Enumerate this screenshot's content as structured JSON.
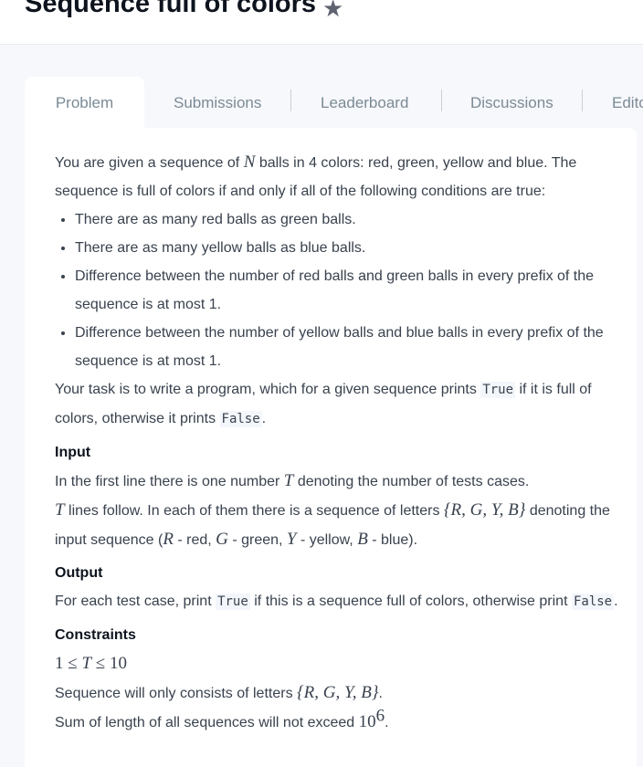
{
  "header": {
    "title": "Sequence full of colors",
    "star_icon": "star-icon"
  },
  "tabs": [
    "Problem",
    "Submissions",
    "Leaderboard",
    "Discussions",
    "Editorial"
  ],
  "content": [
    {
      "kind": "p",
      "segs": [
        [
          "t",
          "You are given a sequence of "
        ],
        [
          "m",
          "N"
        ],
        [
          "t",
          " balls in 4 colors: red, green, yellow and blue. The sequence is full of colors if and only if all of the following conditions are true:"
        ]
      ]
    },
    {
      "kind": "ul",
      "items": [
        [
          [
            "t",
            "There are as many red balls as green balls."
          ]
        ],
        [
          [
            "t",
            "There are as many yellow balls as blue balls."
          ]
        ],
        [
          [
            "t",
            "Difference between the number of red balls and green balls in every prefix of the sequence is at most 1."
          ]
        ],
        [
          [
            "t",
            "Difference between the number of yellow balls and blue balls in every prefix of the sequence is at most 1."
          ]
        ]
      ]
    },
    {
      "kind": "p",
      "segs": [
        [
          "t",
          "Your task is to write a program, which for a given sequence prints "
        ],
        [
          "c",
          "True"
        ],
        [
          "t",
          " if it is full of colors, otherwise it prints "
        ],
        [
          "c",
          "False"
        ],
        [
          "t",
          "."
        ]
      ]
    },
    {
      "kind": "h",
      "text": "Input"
    },
    {
      "kind": "p",
      "segs": [
        [
          "t",
          "In the first line there is one number "
        ],
        [
          "m",
          "T"
        ],
        [
          "t",
          " denoting the number of tests cases."
        ]
      ]
    },
    {
      "kind": "p",
      "segs": [
        [
          "m",
          "T"
        ],
        [
          "t",
          " lines follow. In each of them there is a sequence of letters "
        ],
        [
          "m",
          "{R, G, Y, B}"
        ],
        [
          "t",
          " denoting the input sequence ("
        ],
        [
          "m",
          "R"
        ],
        [
          "t",
          " - red, "
        ],
        [
          "m",
          "G"
        ],
        [
          "t",
          " - green, "
        ],
        [
          "m",
          "Y"
        ],
        [
          "t",
          " - yellow, "
        ],
        [
          "m",
          "B"
        ],
        [
          "t",
          " - blue)."
        ]
      ]
    },
    {
      "kind": "h",
      "text": "Output"
    },
    {
      "kind": "p",
      "segs": [
        [
          "t",
          "For each test case, print "
        ],
        [
          "c",
          "True"
        ],
        [
          "t",
          " if this is a sequence full of colors, otherwise print "
        ],
        [
          "c",
          "False"
        ],
        [
          "t",
          "."
        ]
      ]
    },
    {
      "kind": "h",
      "text": "Constraints"
    },
    {
      "kind": "p",
      "segs": [
        [
          "mu",
          "1 ≤ "
        ],
        [
          "m",
          "T"
        ],
        [
          "mu",
          " ≤ 10"
        ]
      ]
    },
    {
      "kind": "p",
      "segs": [
        [
          "t",
          "Sequence will only consists of letters "
        ],
        [
          "m",
          "{R, G, Y, B}"
        ],
        [
          "t",
          "."
        ]
      ]
    },
    {
      "kind": "p",
      "segs": [
        [
          "t",
          "Sum of length of all sequences will not exceed "
        ],
        [
          "mu",
          "10"
        ],
        [
          "s",
          "6"
        ],
        [
          "t",
          "."
        ]
      ]
    }
  ]
}
